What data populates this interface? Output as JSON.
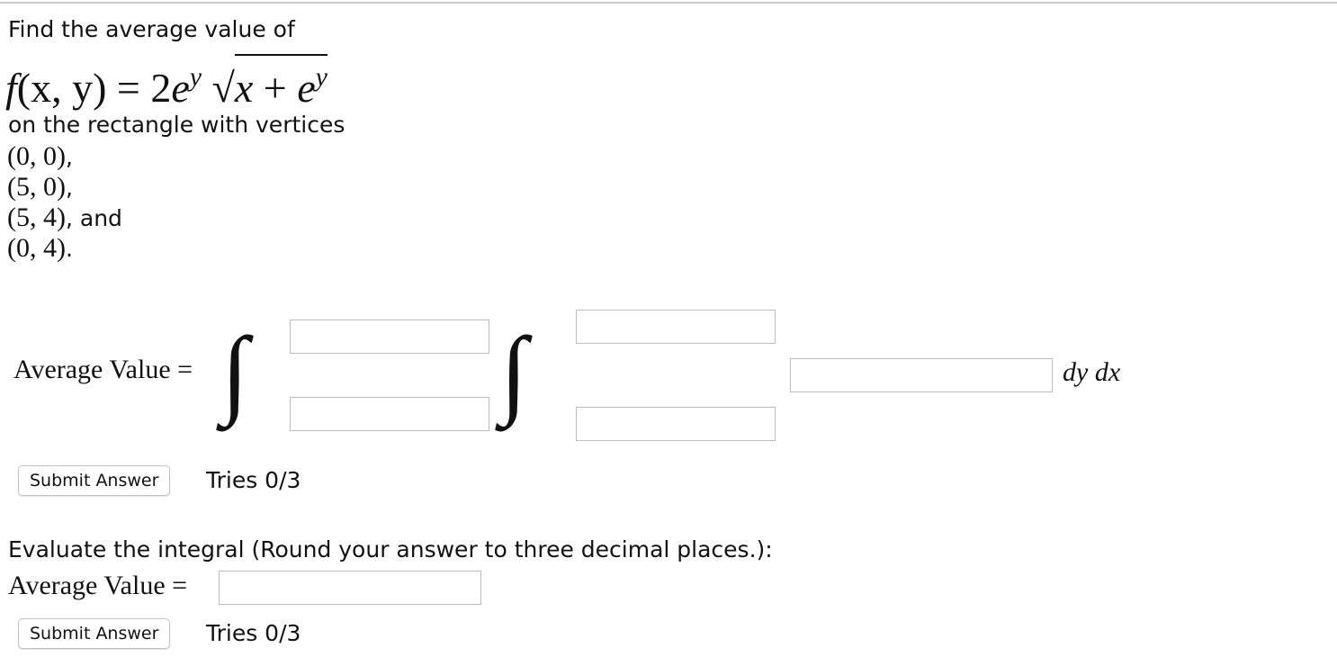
{
  "problem": {
    "prompt": "Find the average value of",
    "function": {
      "lhs_f": "f",
      "lhs_args": "(x, y)",
      "equals": " = ",
      "coef": "2",
      "e": "e",
      "exp_y": "y",
      "radical": "√",
      "rad_x": "x",
      "plus": " + ",
      "rad_e": "e",
      "rad_exp": "y"
    },
    "rectangle_text": "on the rectangle with vertices",
    "vertices": [
      {
        "point": "(0, 0)",
        "tail": ","
      },
      {
        "point": "(5, 0)",
        "tail": ","
      },
      {
        "point": "(5, 4)",
        "tail": ", and"
      },
      {
        "point": "(0, 4)",
        "tail": "."
      }
    ]
  },
  "integral_setup": {
    "label": "Average Value =",
    "outer_symbol": "∫",
    "inner_symbol": "∫",
    "outer_upper": "",
    "outer_lower": "",
    "inner_upper": "",
    "inner_lower": "",
    "integrand": "",
    "differentials": "dy dx",
    "submit_label": "Submit Answer",
    "tries": "Tries 0/3"
  },
  "evaluate": {
    "instruction": "Evaluate the integral (Round your answer to three decimal places.):",
    "label": "Average Value =",
    "answer": "",
    "submit_label": "Submit Answer",
    "tries": "Tries 0/3"
  }
}
